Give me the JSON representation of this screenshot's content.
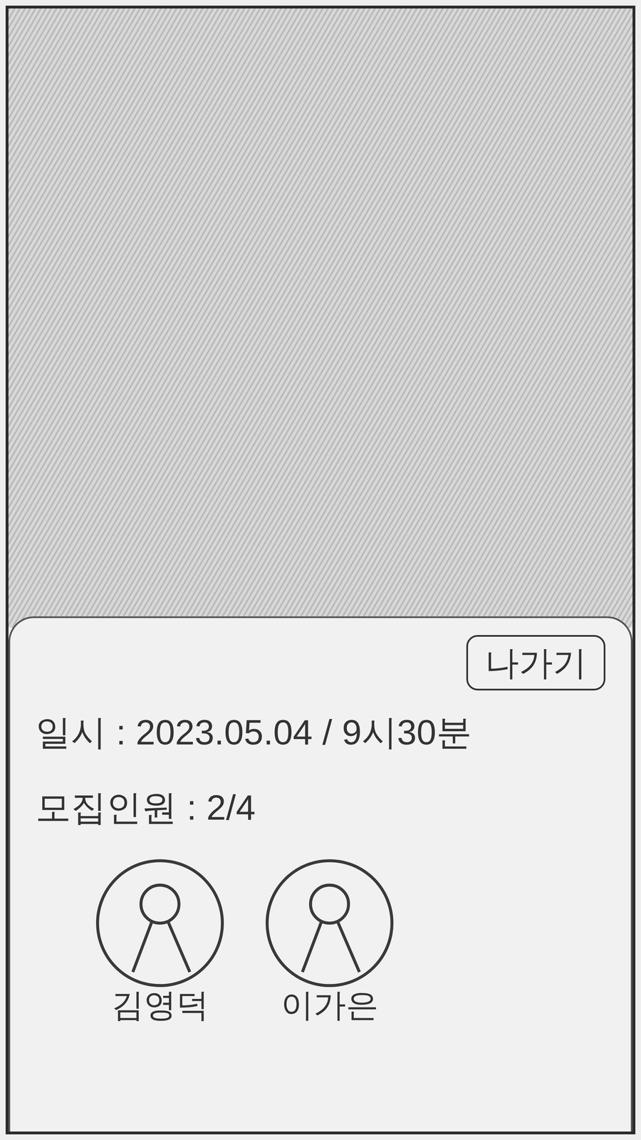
{
  "exit_button": {
    "label": "나가기"
  },
  "details": [
    "일시 : 2023.05.04 / 9시30분",
    "모집인원 : 2/4"
  ],
  "participants": [
    {
      "name": "김영덕"
    },
    {
      "name": "이가은"
    }
  ]
}
